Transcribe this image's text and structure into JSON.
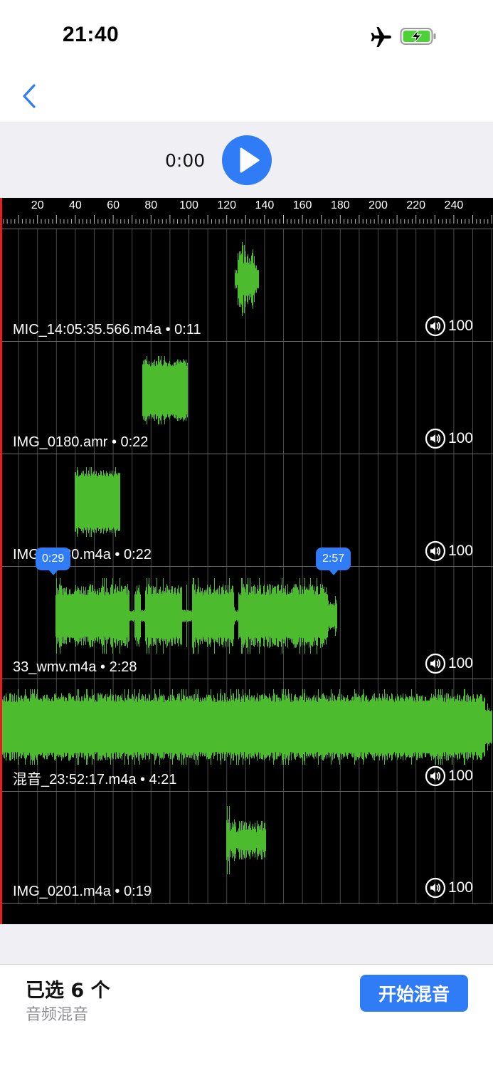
{
  "status": {
    "time": "21:40"
  },
  "player": {
    "time": "0:00"
  },
  "ruler": {
    "ticks": [
      "20",
      "40",
      "60",
      "80",
      "100",
      "120",
      "140",
      "160",
      "180",
      "200",
      "220",
      "240"
    ]
  },
  "tracks": [
    {
      "label": "MIC_14:05:35.566.m4a • 0:11",
      "volume": "100"
    },
    {
      "label": "IMG_0180.amr • 0:22",
      "volume": "100"
    },
    {
      "label": "IMG_0180.m4a • 0:22",
      "volume": "100"
    },
    {
      "label": "33_wmv.m4a • 2:28",
      "volume": "100"
    },
    {
      "label": "混音_23:52:17.m4a • 4:21",
      "volume": "100"
    },
    {
      "label": "IMG_0201.m4a • 0:19",
      "volume": "100"
    }
  ],
  "markers": {
    "start": "0:29",
    "end": "2:57"
  },
  "footer": {
    "selected": "已选 6 个",
    "subtitle": "音频混音",
    "mix_button": "开始混音"
  },
  "colors": {
    "accent": "#2f7cf6",
    "waveform": "#4cbb2e",
    "playhead": "#e02020"
  }
}
